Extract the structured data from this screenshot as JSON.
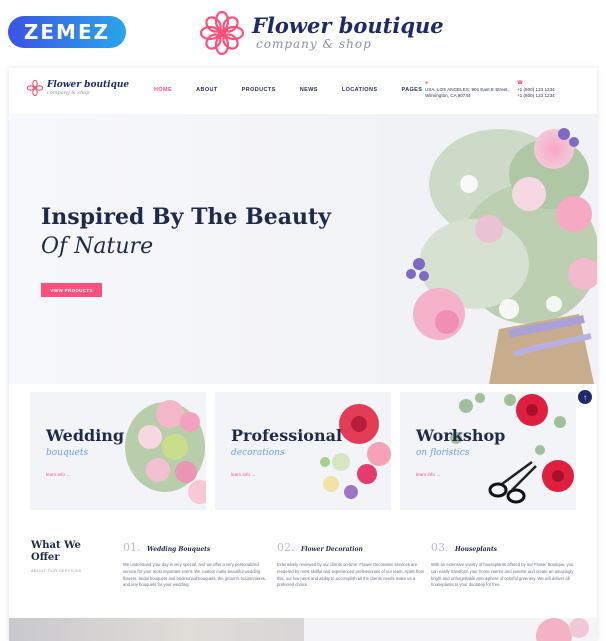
{
  "promo": {
    "badge": "ZEMEZ",
    "brand_name": "Flower boutique",
    "brand_tagline": "company & shop"
  },
  "header": {
    "logo_name": "Flower boutique",
    "logo_tagline": "company & shop",
    "nav": [
      {
        "label": "HOME",
        "active": true
      },
      {
        "label": "ABOUT",
        "active": false
      },
      {
        "label": "PRODUCTS",
        "active": false
      },
      {
        "label": "NEWS",
        "active": false
      },
      {
        "label": "LOCATIONS",
        "active": false
      },
      {
        "label": "PAGES",
        "active": false
      }
    ],
    "address_line1": "USA, LOS ANGELES, 901 East E Street,",
    "address_line2": "Wilmington, CA 90744",
    "phone1": "+1 (800) 123 1234",
    "phone2": "+1 (800) 123 1234"
  },
  "hero": {
    "title_line1": "Inspired By The Beauty",
    "title_line2": "Of Nature",
    "button_label": "VIEW PRODUCTS"
  },
  "cards": [
    {
      "title": "Wedding",
      "subtitle": "bouquets",
      "link": "learn info →"
    },
    {
      "title": "Professional",
      "subtitle": "decorations",
      "link": "learn info →"
    },
    {
      "title": "Workshop",
      "subtitle": "on floristics",
      "link": "learn info →"
    }
  ],
  "offer": {
    "title": "What We Offer",
    "subtitle": "ABOUT OUR SERVICES",
    "items": [
      {
        "num": "01.",
        "title": "Wedding Bouquets",
        "text": "We understand your day is very special, and we offer a very personalized service for your most important event. We custom make beautiful wedding flowers, bridal bouquets and bridesmaid bouquets, the groom's boutonnieres, and any bouquets for your wedding."
      },
      {
        "num": "02.",
        "title": "Flower Decoration",
        "text": "Extensively reviewed by our clients on-time, Flower Decoration services are rendered by most skillful and experienced professionals of our team. Apart from this, our low rates and ability to accomplish all the clients needs make us a preferred choice."
      },
      {
        "num": "03.",
        "title": "Houseplants",
        "text": "With an extensive variety of houseplants offered by our Flower Boutique, you can easily transform your home interior and exterior and create an amazingly bright and unforgettable atmosphere of colorful greenery. We will deliver all houseplants to your doorstep for free."
      }
    ]
  },
  "colors": {
    "accent": "#ff4f7b",
    "navy": "#1f2a4a",
    "subtitle_blue": "#6aa0e0"
  }
}
